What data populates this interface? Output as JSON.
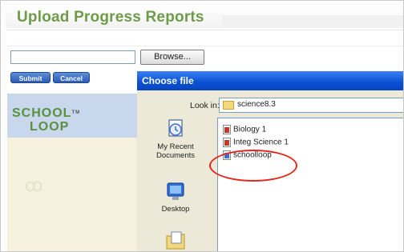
{
  "page": {
    "title": "Upload Progress Reports",
    "browse_label": "Browse...",
    "submit_label": "Submit",
    "cancel_label": "Cancel",
    "logo_line1": "SCHOOL",
    "logo_line2": "LOOP",
    "logo_tm": "TM"
  },
  "dialog": {
    "title": "Choose file",
    "look_in_label": "Look in:",
    "look_in_value": "science8.3",
    "places": [
      {
        "label": "My Recent Documents",
        "icon": "recent-documents-icon"
      },
      {
        "label": "Desktop",
        "icon": "desktop-icon"
      },
      {
        "label": "",
        "icon": "my-documents-icon"
      }
    ],
    "files": [
      {
        "name": "Biology 1",
        "icon": "document-icon"
      },
      {
        "name": "Integ Science 1",
        "icon": "document-icon"
      },
      {
        "name": "schoolloop",
        "icon": "shortcut-icon"
      }
    ]
  },
  "colors": {
    "title_green": "#6e9b4a",
    "dialog_titlebar_blue": "#0a4fd1",
    "highlight_circle_red": "#e5261d",
    "button_blue": "#2b5cb3"
  }
}
